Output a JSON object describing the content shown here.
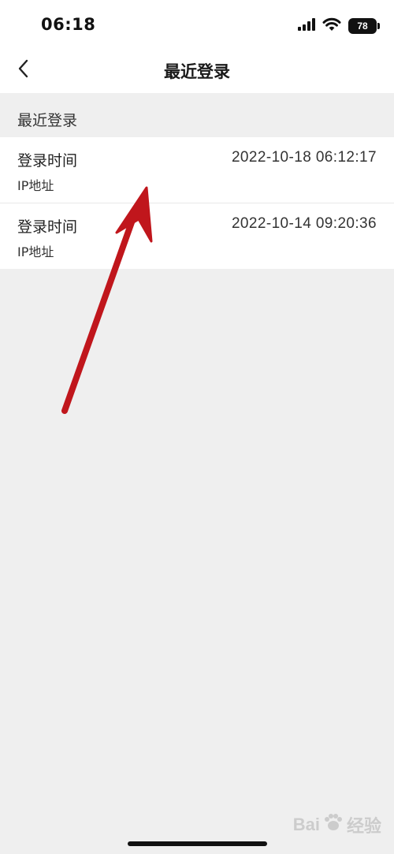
{
  "status_bar": {
    "time": "06:18",
    "battery": "78",
    "icons": [
      "signal-icon",
      "wifi-icon",
      "battery-icon"
    ]
  },
  "nav": {
    "back_icon": "chevron-left-icon",
    "title": "最近登录"
  },
  "section": {
    "header": "最近登录"
  },
  "records": [
    {
      "label": "登录时间",
      "ip_label": "IP地址",
      "time": "2022-10-18 06:12:17"
    },
    {
      "label": "登录时间",
      "ip_label": "IP地址",
      "time": "2022-10-14 09:20:36"
    }
  ],
  "annotation": {
    "color": "#c0161c",
    "icon": "red-arrow-annotation"
  },
  "watermark": {
    "text": "Bai",
    "suffix": "经验",
    "icon": "paw-logo-icon"
  },
  "colors": {
    "background": "#efefef",
    "surface": "#ffffff",
    "text": "#1f1f1f"
  }
}
